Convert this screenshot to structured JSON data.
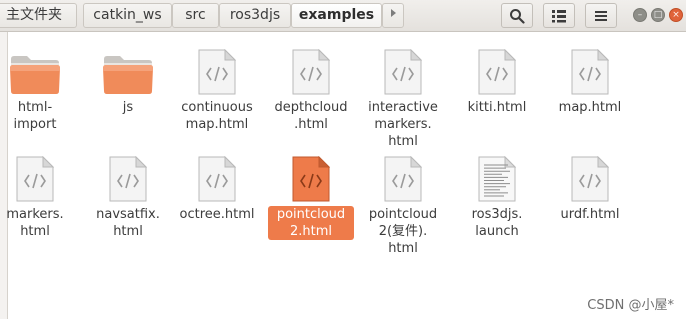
{
  "window": {
    "breadcrumbs": [
      "主文件夹",
      "catkin_ws",
      "src",
      "ros3djs",
      "examples"
    ],
    "overflow_icon": "triangle-right-icon",
    "toolbar_icons": [
      "search-icon",
      "grid-view-icon",
      "menu-icon"
    ],
    "window_controls": [
      "minimize-icon",
      "maximize-icon",
      "close-icon"
    ],
    "accent_color": "#ee7b4a",
    "folder_color": "#f08b5a"
  },
  "files": [
    {
      "label": "html-\nimport",
      "kind": "folder"
    },
    {
      "label": "js",
      "kind": "folder"
    },
    {
      "label": "continuous\nmap.html",
      "kind": "html"
    },
    {
      "label": "depthcloud\n.html",
      "kind": "html"
    },
    {
      "label": "interactive\nmarkers.\nhtml",
      "kind": "html"
    },
    {
      "label": "kitti.html",
      "kind": "html"
    },
    {
      "label": "map.html",
      "kind": "html"
    },
    {
      "label": "markers.\nhtml",
      "kind": "html"
    },
    {
      "label": "navsatfix.\nhtml",
      "kind": "html"
    },
    {
      "label": "octree.html",
      "kind": "html"
    },
    {
      "label": "pointcloud\n2.html",
      "kind": "html",
      "selected": true
    },
    {
      "label": "pointcloud\n2(复件).\nhtml",
      "kind": "html"
    },
    {
      "label": "ros3djs.\nlaunch",
      "kind": "text"
    },
    {
      "label": "urdf.html",
      "kind": "html"
    }
  ],
  "watermark": "CSDN @小屋*"
}
